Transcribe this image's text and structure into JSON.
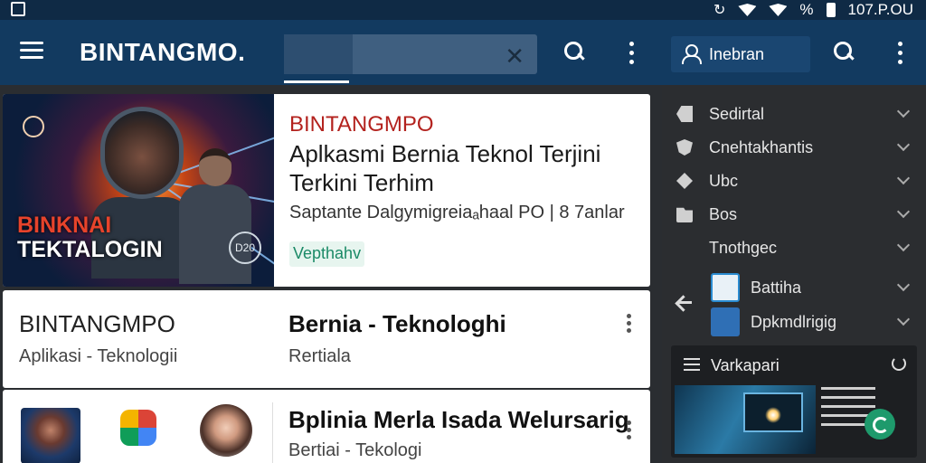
{
  "statusbar": {
    "battery_label": "%",
    "time": "107.P.OU"
  },
  "topbar": {
    "brand": "BINTANGMO.",
    "account_label": "Inebran"
  },
  "cards": {
    "featured": {
      "hero_title_1": "BINKNAI",
      "hero_title_2": "TEKTALOGIN",
      "hero_badge": "D20",
      "brand": "BINTANGMPO",
      "title": "Aplkasmi Bernia Teknol Terjini Terkini Terhim",
      "meta": "Saptante Dalgymigreiaₐhaal PO | 8 7anlar",
      "tag": "Vepthahv"
    },
    "second": {
      "brand": "BINTANGMPO",
      "subtitle": "Aplikasi - Teknologii",
      "title": "Bernia - Teknologhi",
      "subtitle_2": "Rertiala"
    },
    "third": {
      "title": "Bplinia Merla Isada Welursarig",
      "subtitle": "Bertiai - Tekologi"
    }
  },
  "sidebar": {
    "items": [
      {
        "label": "Sedirtal",
        "icon": "tag-icon"
      },
      {
        "label": "Cnehtakhantis",
        "icon": "shield-icon"
      },
      {
        "label": "Ubc",
        "icon": "diamond-icon"
      },
      {
        "label": "Bos",
        "icon": "folder-icon"
      },
      {
        "label": "Tnothgec",
        "icon": ""
      }
    ],
    "apps": [
      {
        "label": "Battiha",
        "color": "#e9f1f7"
      },
      {
        "label": "Dpkmdlrigig",
        "color": "#2f6fb5"
      }
    ],
    "widget": {
      "title": "Varkapari"
    }
  }
}
